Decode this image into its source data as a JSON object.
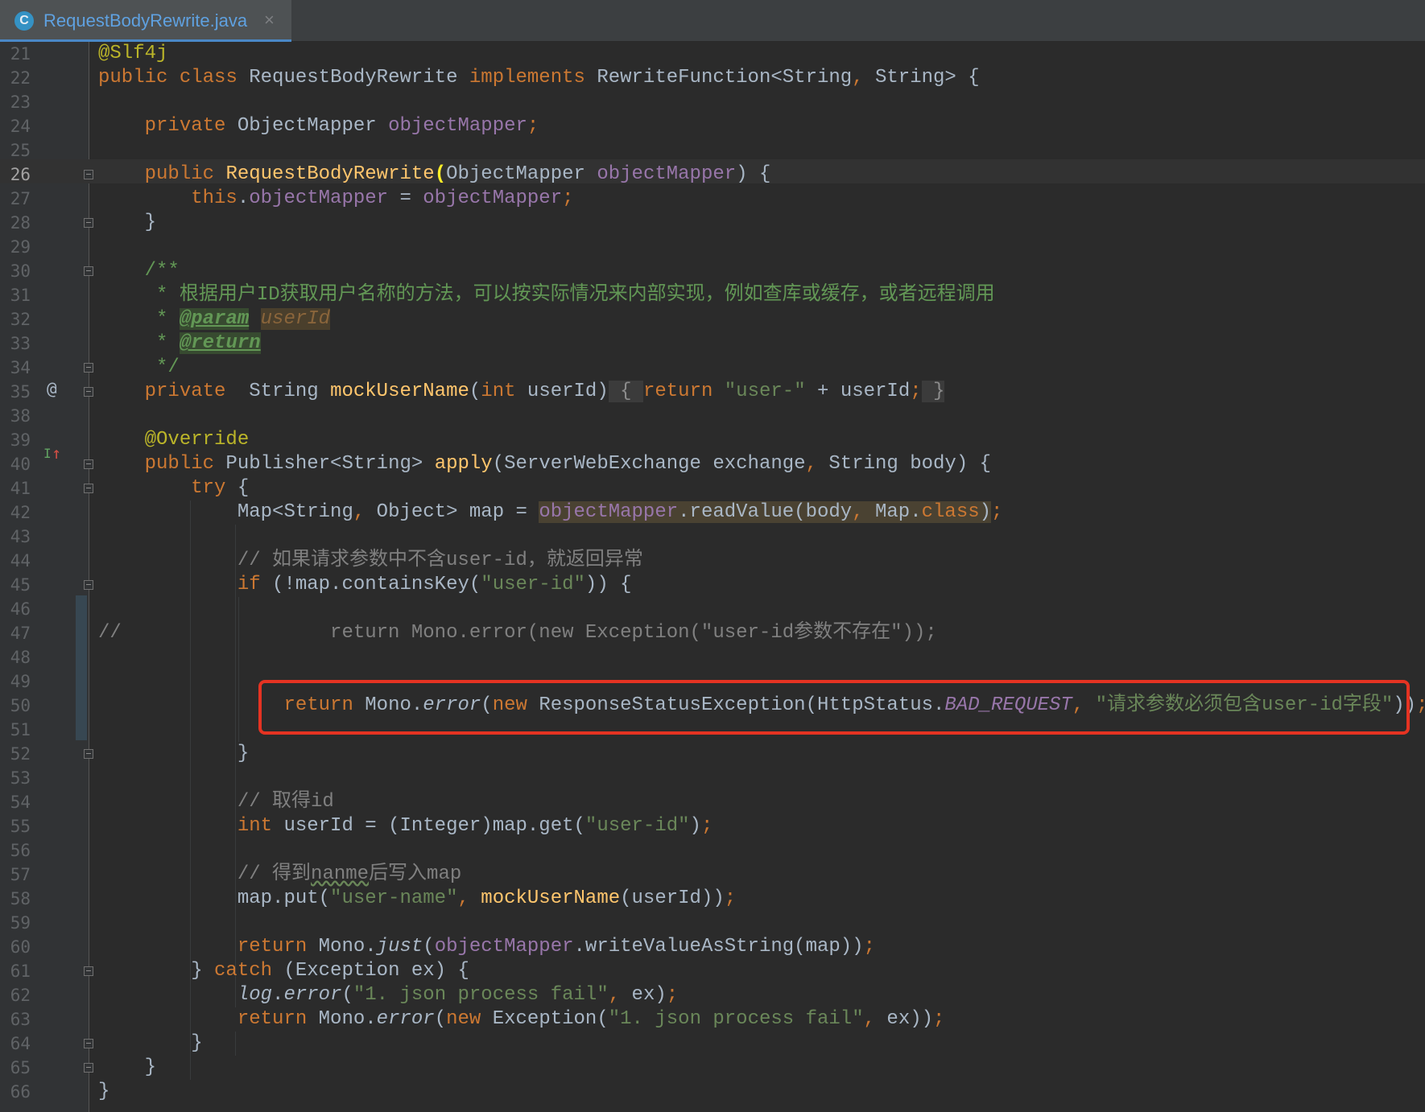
{
  "tab": {
    "icon_letter": "C",
    "file_name": "RequestBodyRewrite.java",
    "close_glyph": "×",
    "icon": "java-class-icon"
  },
  "gutter": {
    "override_marker": "@",
    "implements_marker": "I",
    "implements_arrow": "↑"
  },
  "lines": [
    {
      "n": "21",
      "code": "@Slf4j"
    },
    {
      "n": "22",
      "code": "public class RequestBodyRewrite implements RewriteFunction<String, String> {"
    },
    {
      "n": "23",
      "code": ""
    },
    {
      "n": "24",
      "code": "    private ObjectMapper objectMapper;"
    },
    {
      "n": "25",
      "code": ""
    },
    {
      "n": "26",
      "code": "    public RequestBodyRewrite(ObjectMapper objectMapper) {"
    },
    {
      "n": "27",
      "code": "        this.objectMapper = objectMapper;"
    },
    {
      "n": "28",
      "code": "    }"
    },
    {
      "n": "29",
      "code": ""
    },
    {
      "n": "30",
      "code": "    /**"
    },
    {
      "n": "31",
      "code": "     * 根据用户ID获取用户名称的方法，可以按实际情况来内部实现，例如查库或缓存，或者远程调用"
    },
    {
      "n": "32",
      "code": "     * @param userId"
    },
    {
      "n": "33",
      "code": "     * @return"
    },
    {
      "n": "34",
      "code": "     */"
    },
    {
      "n": "35",
      "code": "    private  String mockUserName(int userId) { return \"user-\" + userId; }"
    },
    {
      "n": "38",
      "code": ""
    },
    {
      "n": "39",
      "code": "    @Override"
    },
    {
      "n": "40",
      "code": "    public Publisher<String> apply(ServerWebExchange exchange, String body) {"
    },
    {
      "n": "41",
      "code": "        try {"
    },
    {
      "n": "42",
      "code": "            Map<String, Object> map = objectMapper.readValue(body, Map.class);"
    },
    {
      "n": "43",
      "code": ""
    },
    {
      "n": "44",
      "code": "            // 如果请求参数中不含user-id，就返回异常"
    },
    {
      "n": "45",
      "code": "            if (!map.containsKey(\"user-id\")) {"
    },
    {
      "n": "46",
      "code": ""
    },
    {
      "n": "47",
      "code": "//                  return Mono.error(new Exception(\"user-id参数不存在\"));"
    },
    {
      "n": "48",
      "code": ""
    },
    {
      "n": "49",
      "code": ""
    },
    {
      "n": "50",
      "code": "                return Mono.error(new ResponseStatusException(HttpStatus.BAD_REQUEST, \"请求参数必须包含user-id字段\"));"
    },
    {
      "n": "51",
      "code": ""
    },
    {
      "n": "52",
      "code": "            }"
    },
    {
      "n": "53",
      "code": ""
    },
    {
      "n": "54",
      "code": "            // 取得id"
    },
    {
      "n": "55",
      "code": "            int userId = (Integer)map.get(\"user-id\");"
    },
    {
      "n": "56",
      "code": ""
    },
    {
      "n": "57",
      "code": "            // 得到nanme后写入map"
    },
    {
      "n": "58",
      "code": "            map.put(\"user-name\", mockUserName(userId));"
    },
    {
      "n": "59",
      "code": ""
    },
    {
      "n": "60",
      "code": "            return Mono.just(objectMapper.writeValueAsString(map));"
    },
    {
      "n": "61",
      "code": "        } catch (Exception ex) {"
    },
    {
      "n": "62",
      "code": "            log.error(\"1. json process fail\", ex);"
    },
    {
      "n": "63",
      "code": "            return Mono.error(new Exception(\"1. json process fail\", ex));"
    },
    {
      "n": "64",
      "code": "        }"
    },
    {
      "n": "65",
      "code": "    }"
    },
    {
      "n": "66",
      "code": "}"
    }
  ],
  "colors": {
    "background": "#2b2b2b",
    "gutter": "#313335",
    "keyword": "#cc7832",
    "annotation": "#bbb529",
    "field": "#9876aa",
    "method": "#ffc66d",
    "string": "#6a8759",
    "comment": "#808080",
    "doc_comment": "#629755",
    "highlight_box": "#e53322"
  }
}
